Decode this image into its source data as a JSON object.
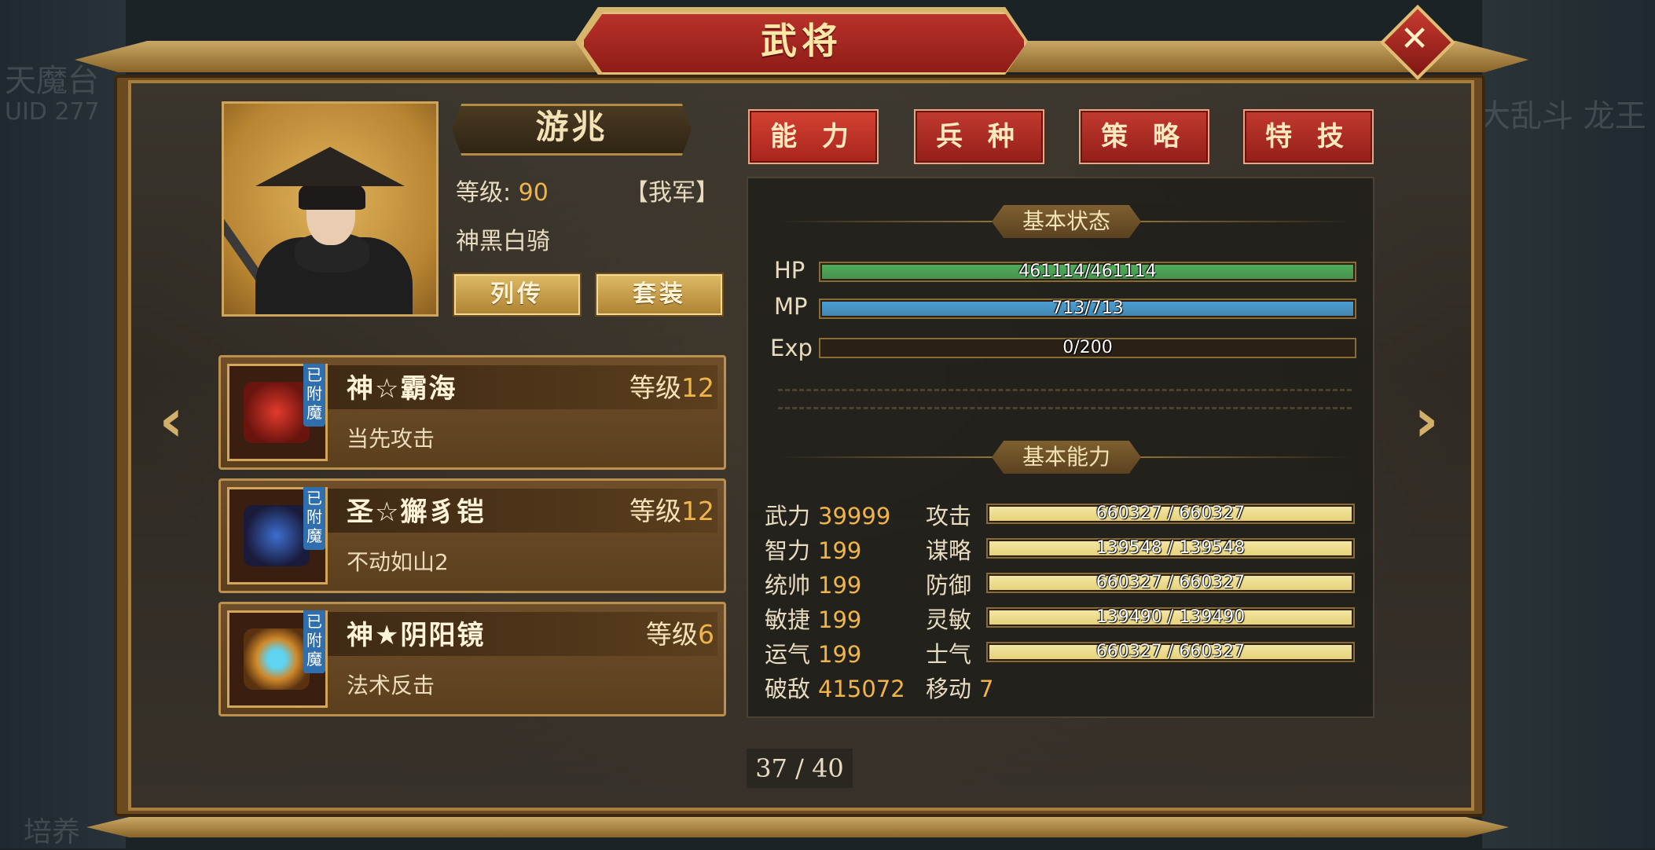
{
  "background": {
    "left_faint_1": "天魔台",
    "left_faint_2": "UID  277",
    "right_faint": "大乱斗 龙王",
    "bottom_left_faint": "培养"
  },
  "window": {
    "title": "武将",
    "close_icon": "close-x-icon"
  },
  "hero": {
    "name": "游兆",
    "level_label": "等级:",
    "level_value": "90",
    "faction": "【我军】",
    "title": "神黑白骑",
    "btn_biography": "列传",
    "btn_set": "套装"
  },
  "equipment": [
    {
      "name": "神☆霸海",
      "level_label": "等级",
      "level": "12",
      "skill": "当先攻击",
      "tag": "已附魔",
      "icon": "red-sword-icon"
    },
    {
      "name": "圣☆獬豸铠",
      "level_label": "等级",
      "level": "12",
      "skill": "不动如山2",
      "tag": "已附魔",
      "icon": "blue-armor-icon"
    },
    {
      "name": "神★阴阳镜",
      "level_label": "等级",
      "level": "6",
      "skill": "法术反击",
      "tag": "已附魔",
      "icon": "mirror-icon"
    }
  ],
  "tabs": [
    "能 力",
    "兵 种",
    "策 略",
    "特 技"
  ],
  "basic_status": {
    "title": "基本状态",
    "bars": [
      {
        "label": "HP",
        "text": "461114/461114",
        "fill": 1.0,
        "color": "#4fae5b"
      },
      {
        "label": "MP",
        "text": "713/713",
        "fill": 1.0,
        "color": "#4a9fd4"
      },
      {
        "label": "Exp",
        "text": "0/200",
        "fill": 0.0,
        "color": "#c9a24a"
      }
    ]
  },
  "basic_ability": {
    "title": "基本能力",
    "left": [
      {
        "label": "武力",
        "value": "39999"
      },
      {
        "label": "智力",
        "value": "199"
      },
      {
        "label": "统帅",
        "value": "199"
      },
      {
        "label": "敏捷",
        "value": "199"
      },
      {
        "label": "运气",
        "value": "199"
      },
      {
        "label": "破敌",
        "value": "415072"
      }
    ],
    "right": [
      {
        "label": "攻击",
        "text": "660327 / 660327",
        "fill": 1.0
      },
      {
        "label": "谋略",
        "text": "139548 / 139548",
        "fill": 1.0
      },
      {
        "label": "防御",
        "text": "660327 / 660327",
        "fill": 1.0
      },
      {
        "label": "灵敏",
        "text": "139490 / 139490",
        "fill": 1.0
      },
      {
        "label": "士气",
        "text": "660327 / 660327",
        "fill": 1.0
      }
    ],
    "move_label": "移动",
    "move_value": "7"
  },
  "pagination": "37 / 40",
  "colors": {
    "tab_red": "#a8241c",
    "gold_text": "#f0b54a",
    "attr_bar": "#e6d27a"
  }
}
